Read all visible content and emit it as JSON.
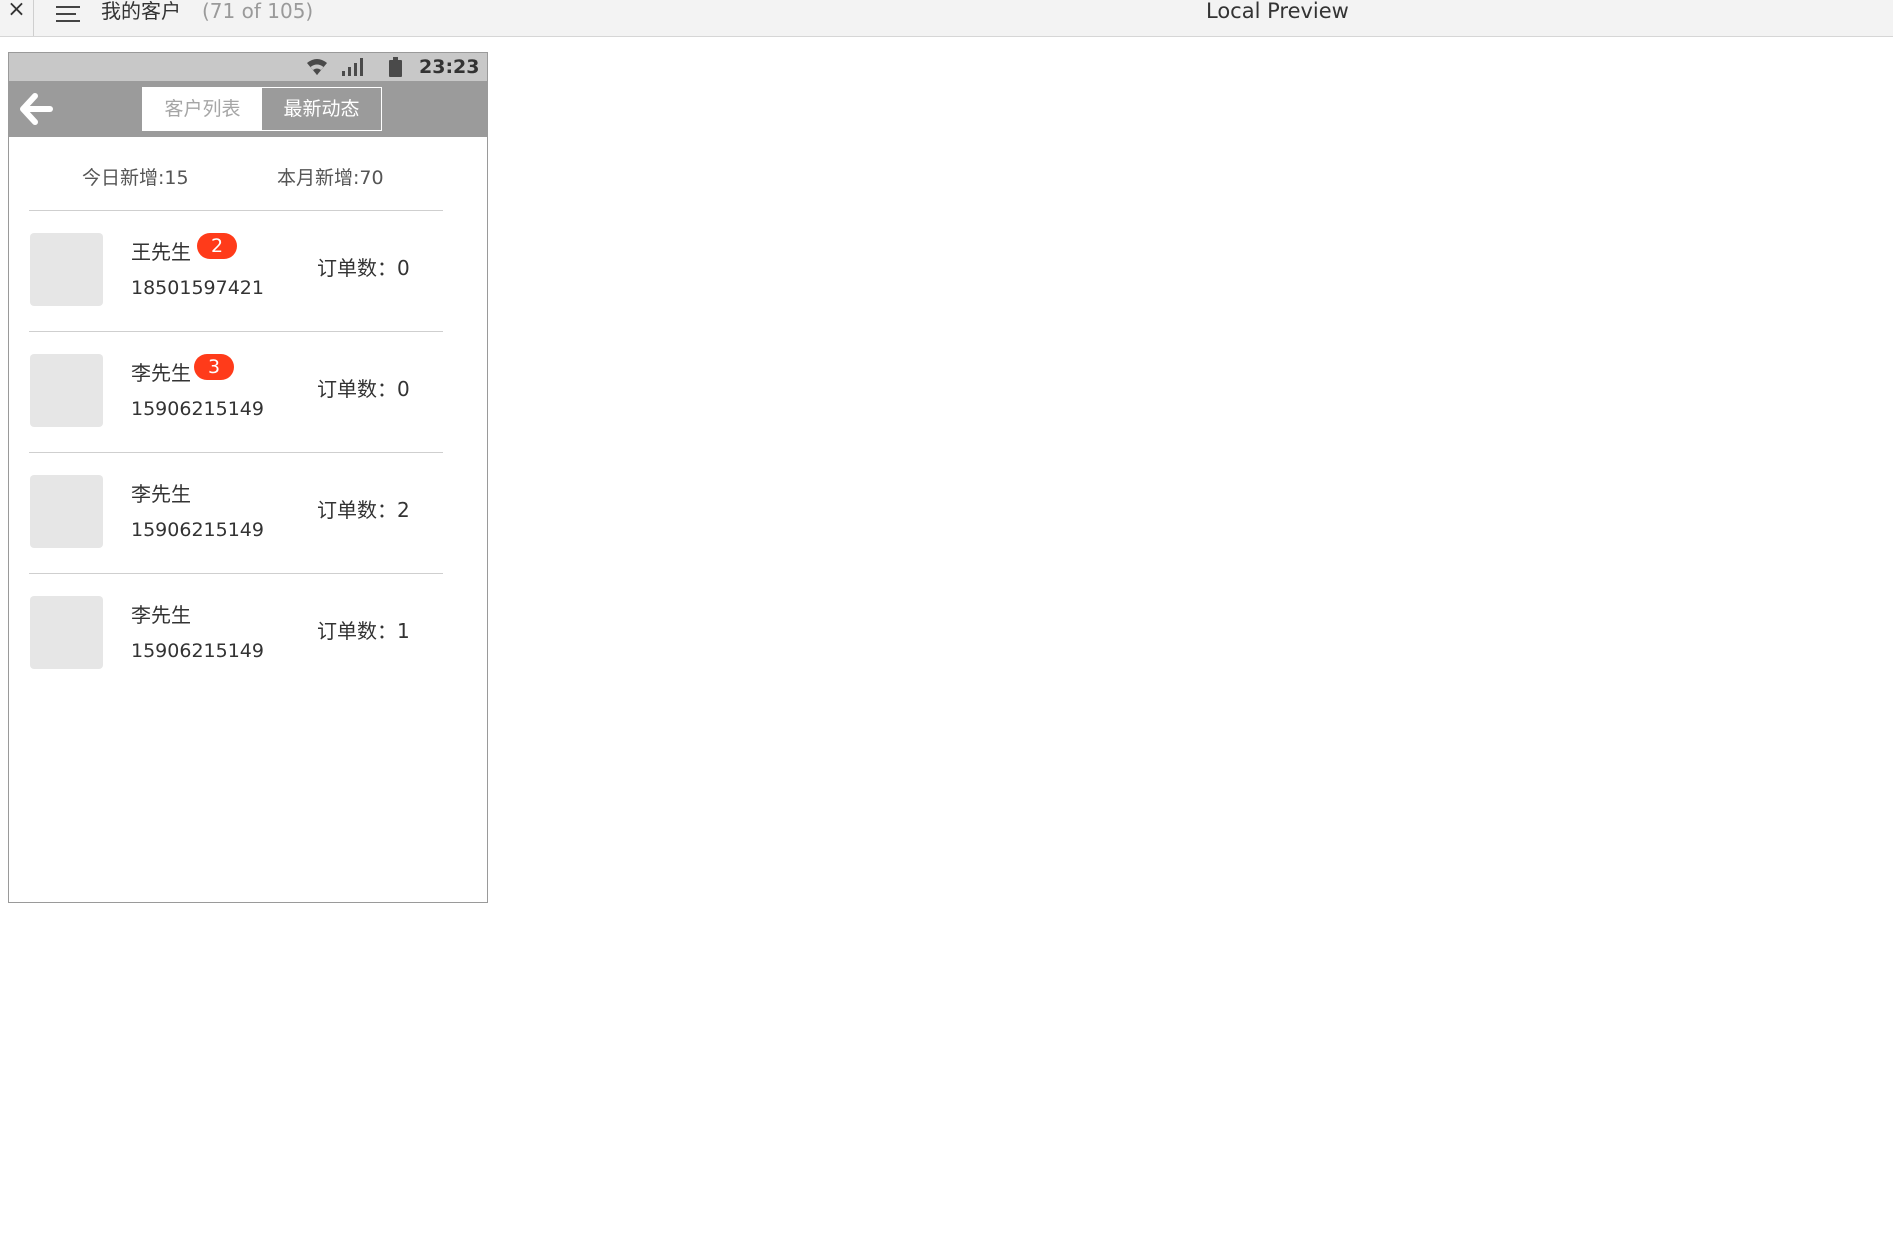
{
  "topbar": {
    "close_glyph": "×",
    "menu_icon": "hamburger-menu-icon",
    "page_name": "我的客户",
    "page_count": "(71 of 105)",
    "preview_title": "Local Preview"
  },
  "phone": {
    "statusbar": {
      "time": "23:23",
      "icons": [
        "wifi-icon",
        "signal-icon",
        "battery-icon"
      ]
    },
    "navbar": {
      "back_icon": "arrow-left-icon",
      "tabs": [
        {
          "label": "客户列表",
          "active": false
        },
        {
          "label": "最新动态",
          "active": true
        }
      ]
    },
    "stats": {
      "today": "今日新增:15",
      "month": "本月新增:70"
    },
    "customers": [
      {
        "name": "王先生",
        "badge": "2",
        "phone": "18501597421",
        "orders": "订单数：0"
      },
      {
        "name": "李先生",
        "badge": "3",
        "phone": "15906215149",
        "orders": "订单数：0"
      },
      {
        "name": "李先生",
        "badge": "",
        "phone": "15906215149",
        "orders": "订单数：2"
      },
      {
        "name": "李先生",
        "badge": "",
        "phone": "15906215149",
        "orders": "订单数：1"
      }
    ]
  },
  "colors": {
    "statusbar_bg": "#c8c8c8",
    "navbar_bg": "#9b9b9b",
    "badge_bg": "#ff3b1a",
    "avatar_bg": "#e6e6e6"
  }
}
